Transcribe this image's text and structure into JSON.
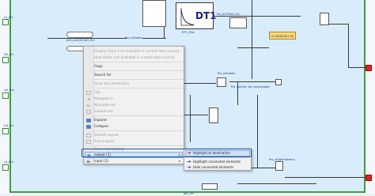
{
  "diagram": {
    "left_ports": [
      {
        "label": "cv_Em"
      },
      {
        "label": "tSt_Em"
      },
      {
        "label": "vel_Em"
      },
      {
        "label": "trd_Em"
      },
      {
        "label": "ve_Em"
      }
    ],
    "dt1_block": {
      "title": "DT1",
      "subtitle": "DT1_Plot"
    },
    "constant_value": "0.000000e+00",
    "signal_labels": {
      "top_right": "Pro_dt1/Plant_Em",
      "mid_right": "Pro_specific_tat_computation",
      "input_a": "Acti_calc/dt1/dt1_Em",
      "bottom_right": "Pro_ref/gen/Nereus",
      "mid_small": "Pro_ref/addm",
      "input_b": "Pro_ref/addm",
      "bottom": "gen_ref"
    }
  },
  "context_menu": {
    "items": [
      {
        "label": "Display Value (not available in current data source)",
        "disabled": true
      },
      {
        "label": "Hide Value (not available in current data source)",
        "disabled": true
      },
      {
        "label": "Copy",
        "disabled": false
      },
      {
        "label": "Search for",
        "disabled": false
      },
      {
        "label": "Show documentation",
        "disabled": true
      },
      {
        "label": "Clip",
        "disabled": true
      },
      {
        "label": "Navigate in",
        "disabled": true
      },
      {
        "label": "Navigate out",
        "disabled": true
      },
      {
        "label": "Expand out",
        "disabled": true
      },
      {
        "label": "Expand",
        "disabled": false
      },
      {
        "label": "Collapse",
        "disabled": false
      },
      {
        "label": "Default Layout",
        "disabled": true
      },
      {
        "label": "Auto Layout",
        "disabled": true
      },
      {
        "label": "Clear Highlighting",
        "disabled": true
      },
      {
        "label": "output (1)",
        "disabled": false
      },
      {
        "label": "input (1)",
        "disabled": false
      }
    ]
  },
  "submenu": {
    "items": [
      {
        "label": "Highlight to destination"
      },
      {
        "label": "Highlight connected elements"
      },
      {
        "label": "Hide connected elements"
      }
    ]
  }
}
